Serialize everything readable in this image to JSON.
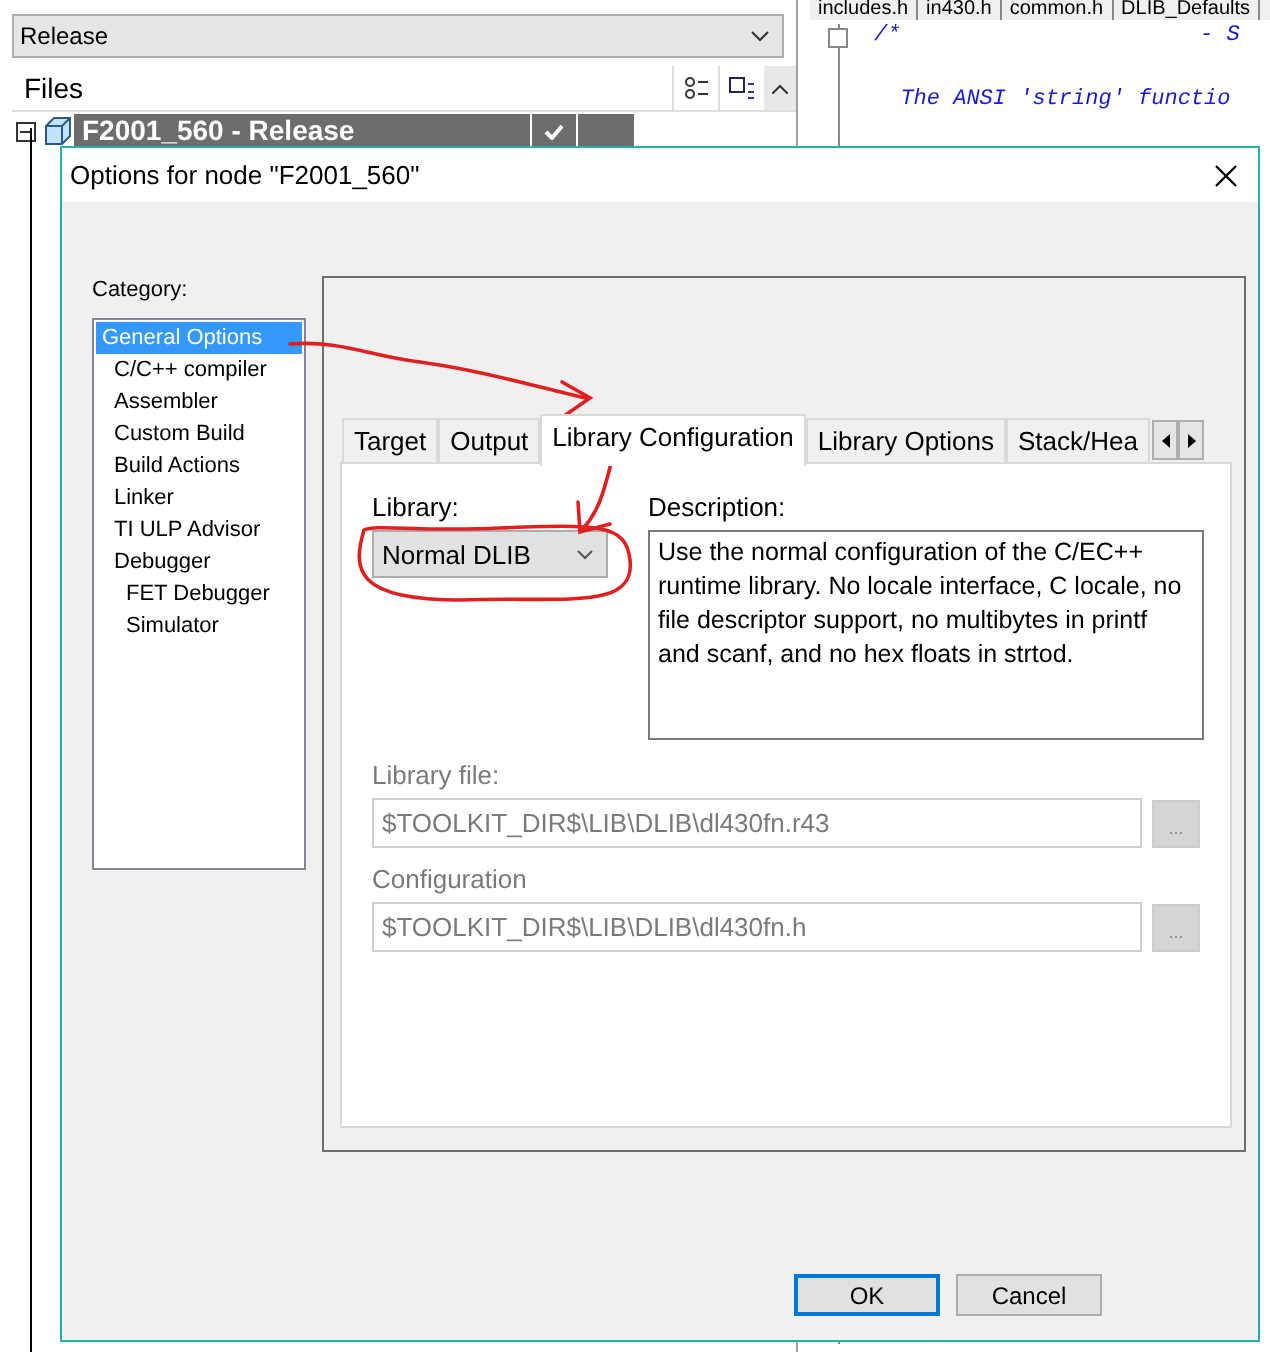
{
  "workspace": {
    "configuration": "Release",
    "files_header": "Files",
    "project": {
      "label": "F2001_560 - Release",
      "selected": true,
      "built": true
    }
  },
  "editor": {
    "tabs": [
      "includes.h",
      "in430.h",
      "common.h",
      "DLIB_Defaults"
    ],
    "lines": [
      {
        "text": "/*",
        "trail": "- S"
      },
      {
        "text": "  The ANSI 'string' functio"
      }
    ]
  },
  "dialog": {
    "title": "Options for node \"F2001_560\"",
    "category_label": "Category:",
    "categories": [
      {
        "label": "General Options",
        "selected": true
      },
      {
        "label": "C/C++ compiler",
        "selected": false
      },
      {
        "label": "Assembler",
        "selected": false
      },
      {
        "label": "Custom Build",
        "selected": false
      },
      {
        "label": "Build Actions",
        "selected": false
      },
      {
        "label": "Linker",
        "selected": false
      },
      {
        "label": "TI ULP Advisor",
        "selected": false
      },
      {
        "label": "Debugger",
        "selected": false,
        "children": [
          {
            "label": "FET Debugger",
            "selected": false
          },
          {
            "label": "Simulator",
            "selected": false
          }
        ]
      }
    ],
    "tabs": [
      {
        "label": "Target",
        "selected": false
      },
      {
        "label": "Output",
        "selected": false
      },
      {
        "label": "Library Configuration",
        "selected": true
      },
      {
        "label": "Library Options",
        "selected": false
      },
      {
        "label": "Stack/Hea",
        "selected": false
      }
    ],
    "library": {
      "label": "Library:",
      "value": "Normal DLIB"
    },
    "description": {
      "label": "Description:",
      "text": "Use the normal configuration of the C/EC++ runtime library. No locale interface, C locale, no file descriptor support, no multibytes in printf and scanf, and no hex floats in strtod."
    },
    "paths": [
      {
        "label": "Library file:",
        "value": "$TOOLKIT_DIR$\\LIB\\DLIB\\dl430fn.r43",
        "disabled": true,
        "browse": "..."
      },
      {
        "label": "Configuration",
        "value": "$TOOLKIT_DIR$\\LIB\\DLIB\\dl430fn.h",
        "disabled": true,
        "browse": "..."
      }
    ],
    "buttons": [
      {
        "label": "OK",
        "default": true
      },
      {
        "label": "Cancel",
        "default": false
      }
    ]
  }
}
